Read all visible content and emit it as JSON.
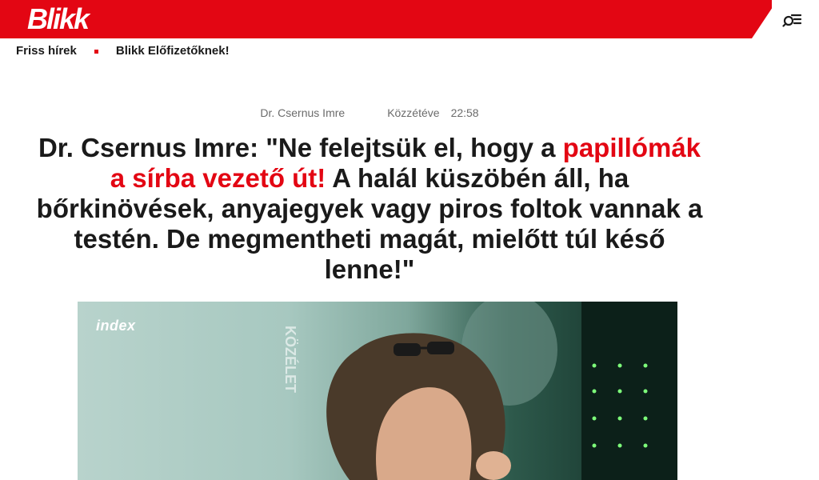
{
  "header": {
    "logo_text": "Blikk",
    "brand_color": "#e30613",
    "menu_icon": "search-menu-icon"
  },
  "subnav": {
    "items": [
      {
        "label": "Friss hírek"
      },
      {
        "label": "Blikk Előfizetőknek!"
      }
    ]
  },
  "article": {
    "author": "Dr. Csernus Imre",
    "published_label": "Közzétéve",
    "published_time": "22:58",
    "headline_part1": "Dr. Csernus Imre: \"Ne felejtsük el, hogy a",
    "headline_highlight": "papillómák a sírba vezető út!",
    "headline_part2": "A halál küszöbén áll, ha bőrkinövések, anyajegyek vagy piros foltok vannak a testén. De megmentheti magát, mielőtt túl késő lenne!\"",
    "image": {
      "watermark": "index",
      "side_text": "KÖZÉLET"
    }
  }
}
